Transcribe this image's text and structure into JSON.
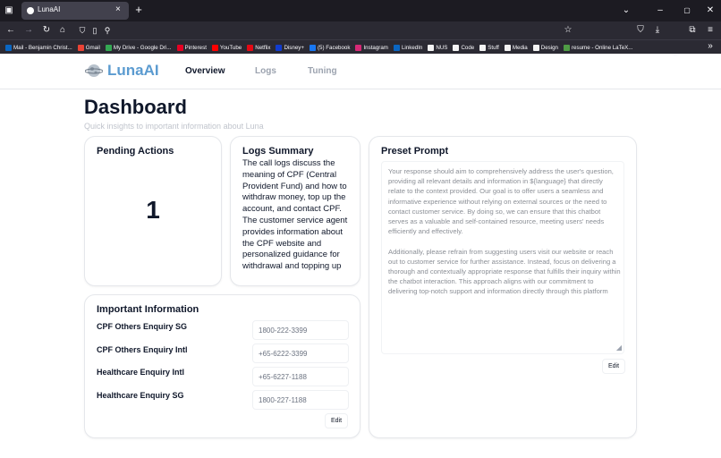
{
  "browser": {
    "tab_title": "LunaAI",
    "tab_close": "×",
    "new_tab": "+",
    "url_host": "localhost",
    "url_port": ":3000",
    "bookmarks": [
      {
        "label": "Mail - Benjamin Christ...",
        "color": "#0a66c2"
      },
      {
        "label": "Gmail",
        "color": "#ea4335"
      },
      {
        "label": "My Drive - Google Dri...",
        "color": "#34a853"
      },
      {
        "label": "Pinterest",
        "color": "#e60023"
      },
      {
        "label": "YouTube",
        "color": "#ff0000"
      },
      {
        "label": "Netflix",
        "color": "#e50914"
      },
      {
        "label": "Disney+",
        "color": "#113ccf"
      },
      {
        "label": "(5) Facebook",
        "color": "#1877f2"
      },
      {
        "label": "Instagram",
        "color": "#d62976"
      },
      {
        "label": "LinkedIn",
        "color": "#0a66c2"
      },
      {
        "label": "NUS",
        "color": "#f3f3f3"
      },
      {
        "label": "Code",
        "color": "#f3f3f3"
      },
      {
        "label": "Stuff",
        "color": "#f3f3f3"
      },
      {
        "label": "Media",
        "color": "#f3f3f3"
      },
      {
        "label": "Design",
        "color": "#f3f3f3"
      },
      {
        "label": "resume - Online LaTeX...",
        "color": "#4f9c45"
      }
    ],
    "more_bookmarks": "»"
  },
  "app": {
    "brand": "LunaAI",
    "brand_color": "#5b9bd0",
    "nav": [
      {
        "label": "Overview",
        "active": true
      },
      {
        "label": "Logs",
        "active": false
      },
      {
        "label": "Tuning",
        "active": false
      }
    ]
  },
  "page": {
    "title": "Dashboard",
    "subtitle": "Quick insights to important information about Luna"
  },
  "pending": {
    "title": "Pending Actions",
    "count": "1"
  },
  "logs": {
    "title": "Logs Summary",
    "text": "The call logs discuss the meaning of CPF (Central Provident Fund) and how to withdraw money, top up the account, and contact CPF. The customer service agent provides information about the CPF website and personalized guidance for withdrawal and topping up"
  },
  "info": {
    "title": "Important Information",
    "items": [
      {
        "label": "CPF Others Enquiry SG",
        "value": "1800-222-3399"
      },
      {
        "label": "CPF Others Enquiry Intl",
        "value": "+65-6222-3399"
      },
      {
        "label": "Healthcare Enquiry Intl",
        "value": "+65-6227-1188"
      },
      {
        "label": "Healthcare Enquiry SG",
        "value": "1800-227-1188"
      }
    ],
    "edit_label": "Edit"
  },
  "preset": {
    "title": "Preset Prompt",
    "text": "Your response should aim to comprehensively address the user's question, providing all relevant details and information in ${language} that directly relate to the context provided. Our goal is to offer users a seamless and informative experience without relying on external sources or the need to contact customer service. By doing so, we can ensure that this chatbot serves as a valuable and self-contained resource, meeting users' needs efficiently and effectively.\n\nAdditionally, please refrain from suggesting users visit our website or reach out to customer service for further assistance. Instead, focus on delivering a thorough and contextually appropriate response that fulfills their inquiry within the chatbot interaction. This approach aligns with our commitment to delivering top-notch support and information directly through this platform",
    "edit_label": "Edit"
  }
}
